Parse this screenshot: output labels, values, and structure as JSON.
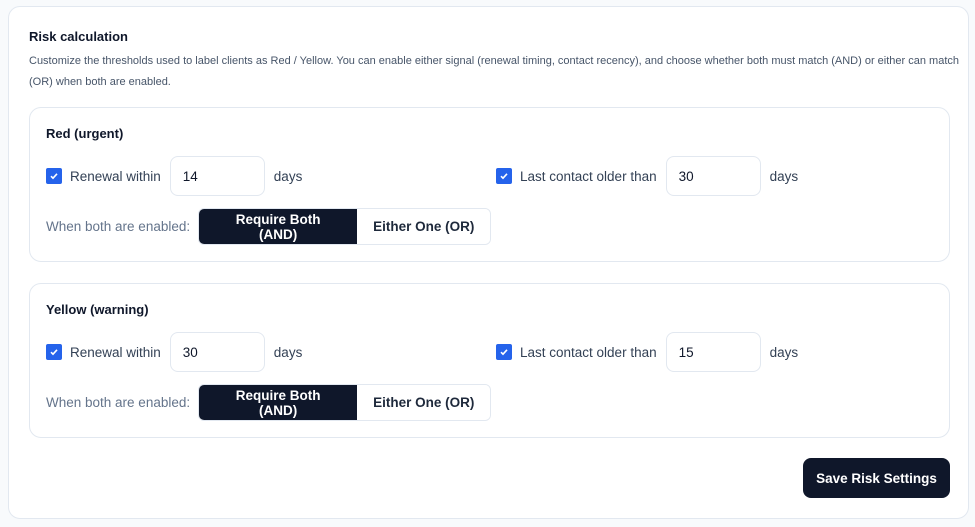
{
  "title": "Risk calculation",
  "description": "Customize the thresholds used to label clients as Red / Yellow. You can enable either signal (renewal timing, contact recency), and choose whether both must match (AND) or either can match (OR) when both are enabled.",
  "panels": [
    {
      "heading": "Red (urgent)",
      "renewal_label": "Renewal within",
      "renewal_value": "14",
      "renewal_checked": true,
      "contact_label": "Last contact older than",
      "contact_value": "30",
      "contact_checked": true,
      "days": "days",
      "mode_label": "When both are enabled:",
      "and_label": "Require Both (AND)",
      "or_label": "Either One (OR)",
      "selected": "AND"
    },
    {
      "heading": "Yellow (warning)",
      "renewal_label": "Renewal within",
      "renewal_value": "30",
      "renewal_checked": true,
      "contact_label": "Last contact older than",
      "contact_value": "15",
      "contact_checked": true,
      "days": "days",
      "mode_label": "When both are enabled:",
      "and_label": "Require Both (AND)",
      "or_label": "Either One (OR)",
      "selected": "AND"
    }
  ],
  "save_label": "Save Risk Settings",
  "colors": {
    "accent": "#2563eb",
    "dark": "#0f172a"
  }
}
